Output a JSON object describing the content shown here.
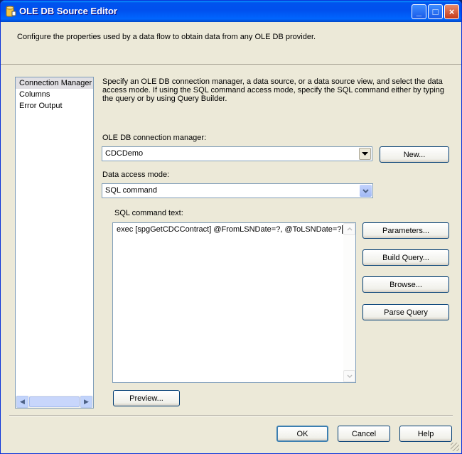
{
  "window": {
    "title": "OLE DB Source Editor",
    "icon": "ssis-component-icon",
    "controls": {
      "minimize": "_",
      "maximize": "□",
      "close": "×"
    }
  },
  "header": {
    "description": "Configure the properties used by a data flow to obtain data from any OLE DB provider."
  },
  "nav": {
    "items": [
      {
        "label": "Connection Manager",
        "selected": true
      },
      {
        "label": "Columns"
      },
      {
        "label": "Error Output"
      }
    ],
    "scroll_left": "◀",
    "scroll_right": "▶"
  },
  "main": {
    "description": "Specify an OLE DB connection manager, a data source, or a data source view, and select the data access mode. If using the SQL command access mode, specify the SQL command either by typing the query or by using Query Builder.",
    "connection_manager": {
      "label": "OLE DB connection manager:",
      "value": "CDCDemo",
      "new_button": "New..."
    },
    "access_mode": {
      "label": "Data access mode:",
      "value": "SQL command"
    },
    "sql": {
      "label": "SQL command text:",
      "value": "exec [spgGetCDCContract] @FromLSNDate=?, @ToLSNDate=?"
    },
    "buttons": {
      "parameters": "Parameters...",
      "build_query": "Build Query...",
      "browse": "Browse...",
      "parse_query": "Parse Query",
      "preview": "Preview..."
    }
  },
  "footer": {
    "ok": "OK",
    "cancel": "Cancel",
    "help": "Help"
  },
  "colors": {
    "titlebar": "#0053ee",
    "dialog_bg": "#ece9d8",
    "selection": "#e0dfe3",
    "field_border": "#7f9db9"
  }
}
